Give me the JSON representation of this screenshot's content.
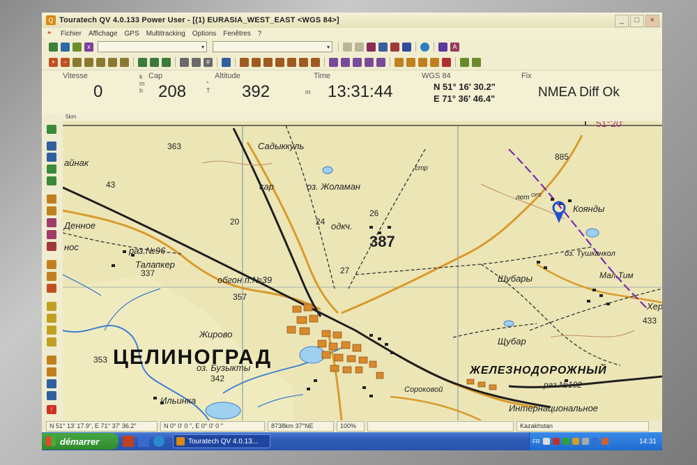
{
  "window": {
    "title": "Touratech QV 4.0.133 Power User - [(1) EURASIA_WEST_EAST <WGS 84>]",
    "controls": {
      "minimize": "_",
      "maximize": "□",
      "close": "×"
    }
  },
  "menu": {
    "items": [
      "Fichier",
      "Affichage",
      "GPS",
      "Multitracking",
      "Options",
      "Fenêtres",
      "?"
    ]
  },
  "gps_panel": {
    "speed": {
      "label": "Vitesse",
      "value": "0",
      "unit": "k m h"
    },
    "heading": {
      "label": "Cap",
      "value": "208",
      "unit": "° T"
    },
    "altitude": {
      "label": "Altitude",
      "value": "392",
      "unit": "m"
    },
    "time": {
      "label": "Time",
      "value": "13:31:44"
    },
    "position": {
      "label": "WGS 84",
      "lat": "N 51°  16' 30.2\"",
      "lon": "E 71°  36' 46.4\""
    },
    "fix": {
      "label": "Fix",
      "value": "NMEA Diff Ok"
    }
  },
  "map": {
    "scale_label": "5km",
    "corner_label": "51°20'",
    "labels": {
      "city": "ЦЕЛИНОГРАД",
      "town": "ЖЕЛЕЗНОДОРОЖНЫЙ",
      "spot_387": "387",
      "spot_363": "363",
      "spot_337": "337",
      "spot_357": "357",
      "spot_353": "353",
      "spot_342": "342",
      "spot_885": "885",
      "spot_433": "433",
      "n43": "43",
      "n20": "20",
      "n24": "24",
      "n26": "26",
      "n27": "27",
      "sadykkul": "Садыккуль",
      "lake_zholaman": "оз. Жоламан",
      "sar": "сар",
      "odkch": "одкч.",
      "raz96": "раз.№96",
      "talapker": "Талапкер",
      "obgon": "обгон п.№39",
      "zhirovo": "Жирово",
      "lake_buzykty": "оз. Бузыкты",
      "ilyinka": "Ильинка",
      "soroka": "Сороковой",
      "internat": "Интернациональное",
      "raz102": "раз.№102",
      "shubary1": "Шубары",
      "shubary2": "Щубар",
      "koyandy": "Коянды",
      "lake_tushkankol": "оз. Тушканкол",
      "mal_tim": "Мал.Тим",
      "let": "лет",
      "gps_tag": "GPS",
      "khern": "Хер",
      "ainak": "айнак",
      "dennoe": "Денное",
      "nos": "нос",
      "str": "стр"
    }
  },
  "statusbar": {
    "cursor": "N 51° 13' 17.9\", E 71° 37' 36.2\"",
    "offset": "N 0° 0' 0 '', E 0° 0' 0 ''",
    "distance": "8738km 37°NE",
    "zoom": "100%",
    "region": "Kazakhstan"
  },
  "taskbar": {
    "start_label": "démarrer",
    "task_label": "Touratech QV 4.0.13...",
    "lang": "FR",
    "clock": "14:31"
  }
}
